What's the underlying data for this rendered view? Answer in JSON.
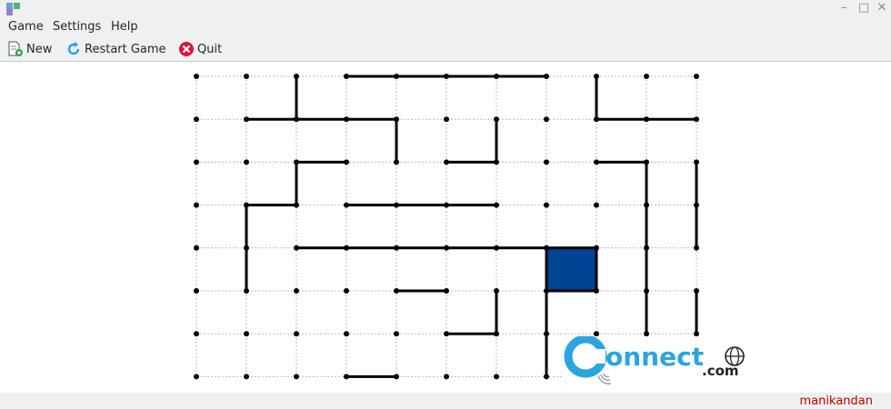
{
  "window": {
    "minimize": "–",
    "maximize": "□",
    "close": "✕"
  },
  "menu": {
    "game": "Game",
    "settings": "Settings",
    "help": "Help"
  },
  "toolbar": {
    "new_label": "New",
    "restart_label": "Restart Game",
    "quit_label": "Quit"
  },
  "status": {
    "user": "manikandan"
  },
  "watermark": {
    "brand": "onnect",
    "suffix": ".com"
  },
  "icons": [
    "app-icon",
    "new-game-icon",
    "restart-icon",
    "quit-icon",
    "globe-icon"
  ],
  "colors": {
    "player_box": "#004593",
    "line": "#000000",
    "status_text": "#bf0000",
    "watermark": "#2aa5e0"
  },
  "board": {
    "rows": 8,
    "cols": 11,
    "h_lines": [
      [
        0,
        3
      ],
      [
        0,
        4
      ],
      [
        0,
        5
      ],
      [
        0,
        6
      ],
      [
        1,
        1
      ],
      [
        1,
        2
      ],
      [
        1,
        3
      ],
      [
        1,
        8
      ],
      [
        1,
        9
      ],
      [
        2,
        2
      ],
      [
        2,
        5
      ],
      [
        2,
        8
      ],
      [
        3,
        1
      ],
      [
        3,
        3
      ],
      [
        3,
        4
      ],
      [
        3,
        5
      ],
      [
        4,
        2
      ],
      [
        4,
        3
      ],
      [
        4,
        4
      ],
      [
        4,
        5
      ],
      [
        4,
        6
      ],
      [
        4,
        7
      ],
      [
        5,
        4
      ],
      [
        5,
        7
      ],
      [
        6,
        5
      ],
      [
        7,
        3
      ]
    ],
    "v_lines": [
      [
        0,
        2
      ],
      [
        0,
        8
      ],
      [
        1,
        4
      ],
      [
        1,
        6
      ],
      [
        2,
        2
      ],
      [
        2,
        9
      ],
      [
        2,
        10
      ],
      [
        3,
        1
      ],
      [
        3,
        9
      ],
      [
        3,
        10
      ],
      [
        4,
        1
      ],
      [
        4,
        7
      ],
      [
        4,
        8
      ],
      [
        4,
        9
      ],
      [
        5,
        6
      ],
      [
        5,
        7
      ],
      [
        5,
        9
      ],
      [
        5,
        10
      ],
      [
        6,
        7
      ],
      [
        6,
        8
      ],
      [
        6,
        10
      ]
    ],
    "filled_boxes": [
      [
        4,
        7
      ]
    ]
  }
}
